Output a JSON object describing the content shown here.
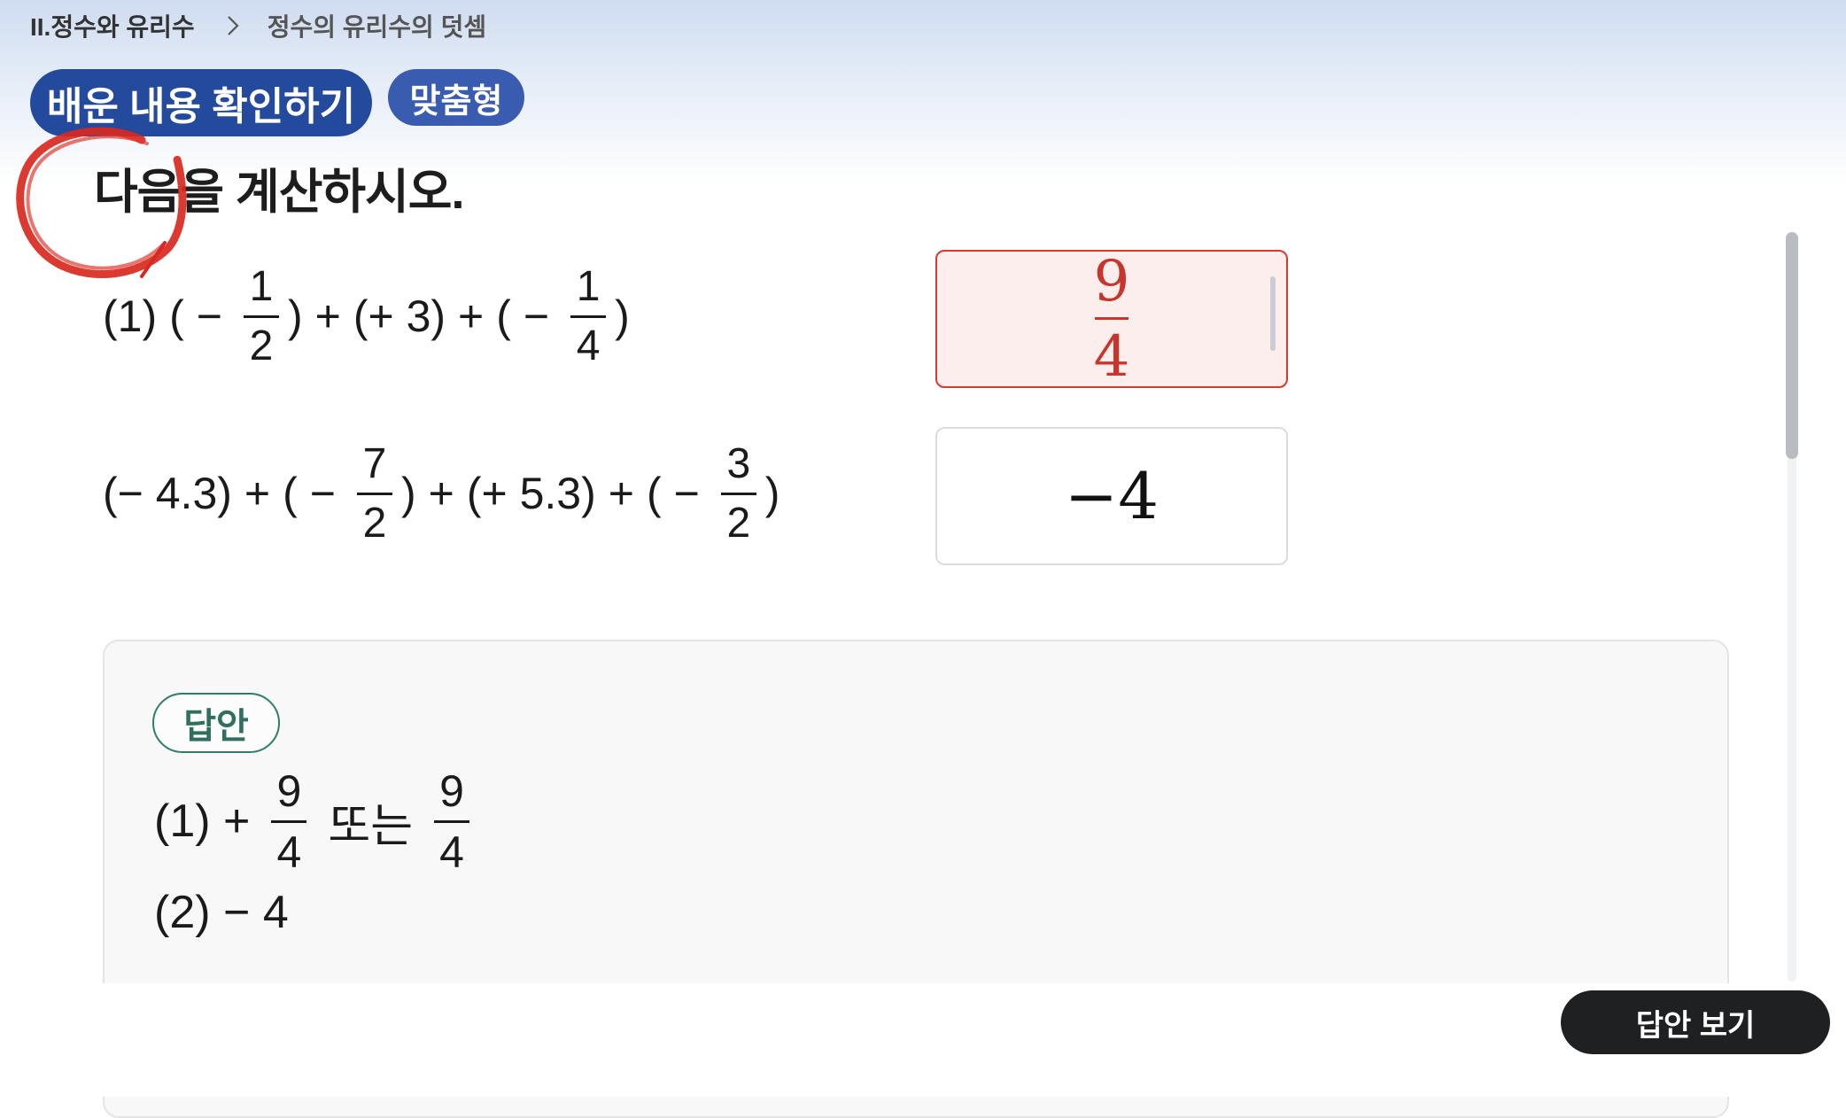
{
  "breadcrumb": {
    "unit": "II.정수와 유리수",
    "current": "정수의 유리수의 덧셈"
  },
  "tags": {
    "main": "배운 내용 확인하기",
    "sub": "맞춤형"
  },
  "instruction": "다음을 계산하시오.",
  "problems": [
    {
      "label": "(1)",
      "tokens": [
        "(",
        "−",
        {
          "num": "1",
          "den": "2"
        },
        ")",
        "+",
        "(+ 3)",
        "+",
        "(",
        "−",
        {
          "num": "1",
          "den": "4"
        },
        ")"
      ]
    },
    {
      "label": "",
      "tokens": [
        "(− 4.3)",
        "+",
        "(",
        "−",
        {
          "num": "7",
          "den": "2"
        },
        ")",
        "+",
        "(+ 5.3)",
        "+",
        "(",
        "−",
        {
          "num": "3",
          "den": "2"
        },
        ")"
      ]
    }
  ],
  "answers": [
    {
      "num": "9",
      "den": "4",
      "status": "incorrect"
    },
    {
      "value": "−4",
      "status": "neutral"
    }
  ],
  "solution": {
    "badge": "답안",
    "line1": {
      "prefix": "(1) +",
      "frac1": {
        "num": "9",
        "den": "4"
      },
      "middle": "또는",
      "frac2": {
        "num": "9",
        "den": "4"
      }
    },
    "line2": "(2) − 4"
  },
  "buttons": {
    "show_answer": "답안 보기"
  },
  "colors": {
    "accent_blue": "#234a9d",
    "error_red": "#d83a30",
    "answer_green": "#2e7d6b",
    "button_dark": "#1f2022"
  },
  "icons": {
    "breadcrumb_separator": "chevron-right-icon",
    "annotation": "red-circle-annotation"
  }
}
